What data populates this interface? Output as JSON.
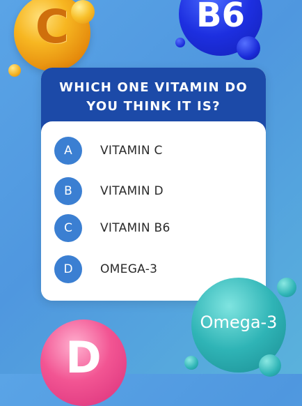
{
  "quiz": {
    "question": "WHICH ONE VITAMIN DO YOU THINK IT IS?",
    "options": [
      {
        "letter": "A",
        "label": "VITAMIN C"
      },
      {
        "letter": "B",
        "label": "VITAMIN D"
      },
      {
        "letter": "C",
        "label": "VITAMIN B6"
      },
      {
        "letter": "D",
        "label": "OMEGA-3"
      }
    ]
  },
  "decorations": {
    "vitamin_c_letter": "C",
    "vitamin_b6_letter": "B6",
    "omega_letter": "Omega-3",
    "vitamin_d_letter": "D"
  },
  "colors": {
    "header_bg": "#1c4aa8",
    "option_circle": "#3b7fd2",
    "background": "#5aa4e6"
  }
}
